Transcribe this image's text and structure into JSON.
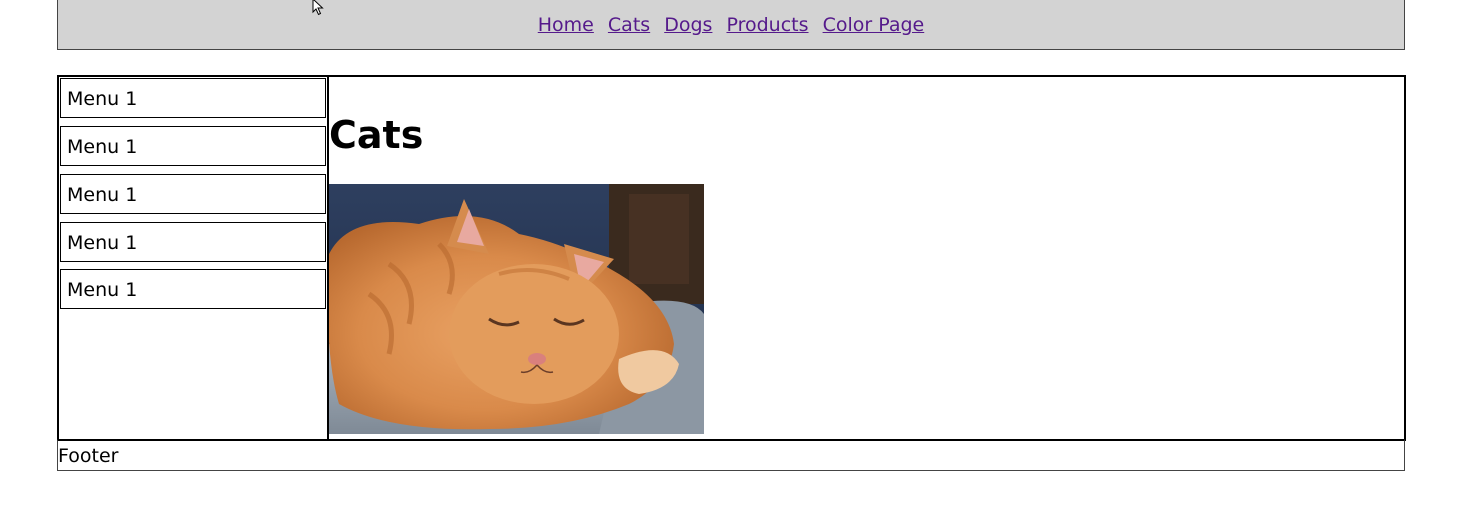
{
  "nav": {
    "links": [
      "Home",
      "Cats",
      "Dogs",
      "Products",
      "Color Page"
    ]
  },
  "sidebar": {
    "items": [
      {
        "label": "Menu 1"
      },
      {
        "label": "Menu 1"
      },
      {
        "label": "Menu 1"
      },
      {
        "label": "Menu 1"
      },
      {
        "label": "Menu 1"
      }
    ]
  },
  "main": {
    "title": "Cats",
    "image_icon": "cat-photo"
  },
  "footer": {
    "text": "Footer"
  },
  "colors": {
    "nav_background": "#d3d3d3",
    "link_color": "#551a8b",
    "border": "#000000"
  }
}
